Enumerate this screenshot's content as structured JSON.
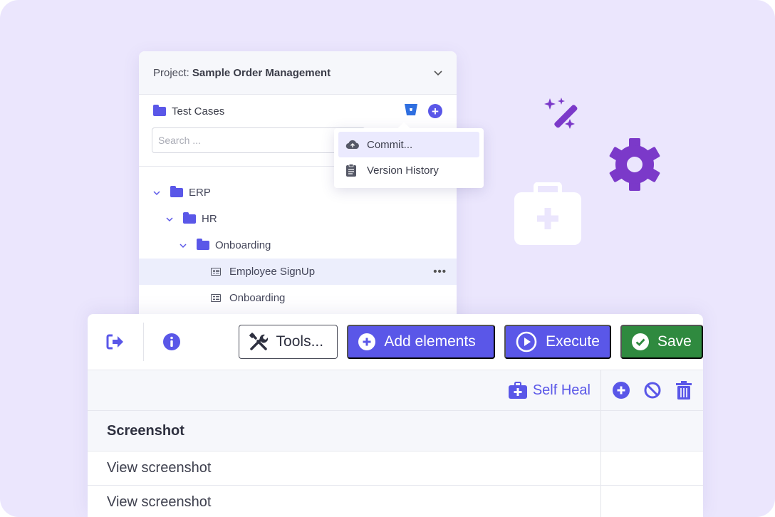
{
  "project": {
    "label": "Project:",
    "name": "Sample Order Management"
  },
  "test_cases": {
    "title": "Test Cases",
    "search_placeholder": "Search ..."
  },
  "menu": {
    "items": [
      {
        "label": "Commit...",
        "icon": "cloud-upload-icon"
      },
      {
        "label": "Version History",
        "icon": "clipboard-icon"
      }
    ]
  },
  "tree": {
    "items": [
      {
        "label": "ERP",
        "type": "folder",
        "level": 0
      },
      {
        "label": "HR",
        "type": "folder",
        "level": 1
      },
      {
        "label": "Onboarding",
        "type": "folder",
        "level": 2
      },
      {
        "label": "Employee SignUp",
        "type": "test",
        "level": 3,
        "selected": true
      },
      {
        "label": "Onboarding",
        "type": "test",
        "level": 3
      }
    ]
  },
  "toolbar": {
    "tools_label": "Tools...",
    "add_label": "Add elements",
    "execute_label": "Execute",
    "save_label": "Save"
  },
  "grid": {
    "self_heal_label": "Self Heal",
    "column_header": "Screenshot",
    "rows": [
      "View screenshot",
      "View screenshot"
    ]
  },
  "colors": {
    "accent": "#5a57e8",
    "save": "#2f8a3f",
    "decor_purple": "#7b39c9",
    "background": "#ebe6fd"
  }
}
